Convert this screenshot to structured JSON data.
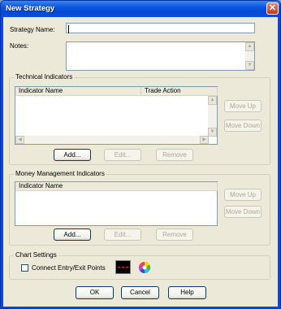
{
  "window": {
    "title": "New Strategy",
    "close_glyph": "✕"
  },
  "strategy_name": {
    "label": "Strategy Name:",
    "value": ""
  },
  "notes": {
    "label": "Notes:",
    "value": ""
  },
  "technical": {
    "group_title": "Technical Indicators",
    "columns": [
      "Indicator Name",
      "Trade Action"
    ],
    "add_label": "Add...",
    "edit_label": "Edit...",
    "remove_label": "Remove",
    "move_up_label": "Move Up",
    "move_down_label": "Move Down"
  },
  "money": {
    "group_title": "Money Management Indicators",
    "columns": [
      "Indicator Name"
    ],
    "add_label": "Add...",
    "edit_label": "Edit...",
    "remove_label": "Remove",
    "move_up_label": "Move Up",
    "move_down_label": "Move Down"
  },
  "chart_settings": {
    "group_title": "Chart Settings",
    "connect_label": "Connect Entry/Exit Points",
    "connect_checked": false,
    "line_color": "#ff2020"
  },
  "footer": {
    "ok_label": "OK",
    "cancel_label": "Cancel",
    "help_label": "Help"
  }
}
